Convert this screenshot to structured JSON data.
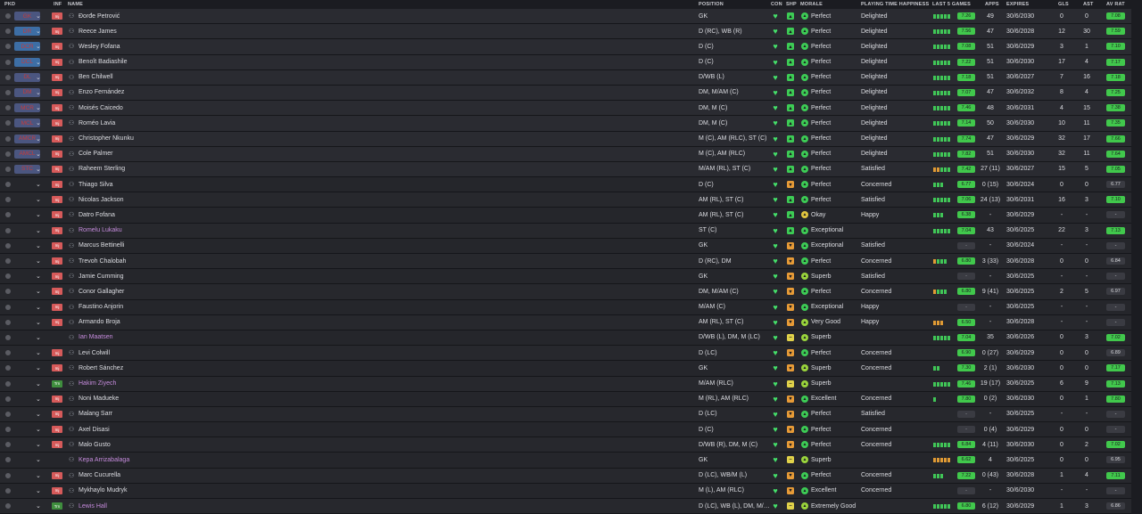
{
  "headers": {
    "pkd": "PKD",
    "inf": "INF",
    "name": "NAME",
    "position": "POSITION",
    "con": "CON",
    "shp": "SHP",
    "morale": "MORALE",
    "pth": "PLAYING TIME HAPPINESS",
    "last5": "LAST 5 GAMES",
    "apps": "APPS",
    "expires": "EXPIRES",
    "gls": "GLS",
    "ast": "AST",
    "avrat": "AV RAT"
  },
  "players": [
    {
      "sel": "GK",
      "inf": "Inj",
      "name": "Đorđe Petrović",
      "position": "GK",
      "morale": "Perfect",
      "pth": "Delighted",
      "last5": "ggggg",
      "rating": "7.26",
      "apps": "49",
      "expires": "30/6/2030",
      "gls": "0",
      "ast": "0",
      "avrat": "7.08"
    },
    {
      "sel": "DR",
      "inf": "Inj",
      "name": "Reece James",
      "position": "D (RC), WB (R)",
      "morale": "Perfect",
      "pth": "Delighted",
      "last5": "ggggg",
      "rating": "7.56",
      "apps": "47",
      "expires": "30/6/2028",
      "gls": "12",
      "ast": "30",
      "avrat": "7.59"
    },
    {
      "sel": "DCR",
      "inf": "Inj",
      "name": "Wesley Fofana",
      "position": "D (C)",
      "morale": "Perfect",
      "pth": "Delighted",
      "last5": "ggggg",
      "rating": "7.08",
      "apps": "51",
      "expires": "30/6/2029",
      "gls": "3",
      "ast": "1",
      "avrat": "7.10"
    },
    {
      "sel": "DCL",
      "inf": "Inj",
      "name": "Benoît Badiashile",
      "position": "D (C)",
      "morale": "Perfect",
      "pth": "Delighted",
      "last5": "ggggg",
      "rating": "7.22",
      "apps": "51",
      "expires": "30/6/2030",
      "gls": "17",
      "ast": "4",
      "avrat": "7.17"
    },
    {
      "sel": "DL",
      "inf": "Inj",
      "name": "Ben Chilwell",
      "position": "D/WB (L)",
      "morale": "Perfect",
      "pth": "Delighted",
      "last5": "ggggg",
      "rating": "7.18",
      "apps": "51",
      "expires": "30/6/2027",
      "gls": "7",
      "ast": "16",
      "avrat": "7.18"
    },
    {
      "sel": "DM",
      "inf": "Inj",
      "name": "Enzo Fernández",
      "position": "DM, M/AM (C)",
      "morale": "Perfect",
      "pth": "Delighted",
      "last5": "ggggg",
      "rating": "7.07",
      "apps": "47",
      "expires": "30/6/2032",
      "gls": "8",
      "ast": "4",
      "avrat": "7.25"
    },
    {
      "sel": "MCR",
      "inf": "Inj",
      "name": "Moisés Caicedo",
      "position": "DM, M (C)",
      "morale": "Perfect",
      "pth": "Delighted",
      "last5": "ggggg",
      "rating": "7.46",
      "apps": "48",
      "expires": "30/6/2031",
      "gls": "4",
      "ast": "15",
      "avrat": "7.38"
    },
    {
      "sel": "MCL",
      "inf": "Inj",
      "name": "Roméo Lavia",
      "position": "DM, M (C)",
      "morale": "Perfect",
      "pth": "Delighted",
      "last5": "ggggg",
      "rating": "7.14",
      "apps": "50",
      "expires": "30/6/2030",
      "gls": "10",
      "ast": "11",
      "avrat": "7.35"
    },
    {
      "sel": "AMCR",
      "inf": "Inj",
      "name": "Christopher Nkunku",
      "position": "M (C), AM (RLC), ST (C)",
      "morale": "Perfect",
      "pth": "Delighted",
      "last5": "ggggg",
      "rating": "7.74",
      "apps": "47",
      "expires": "30/6/2029",
      "gls": "32",
      "ast": "17",
      "avrat": "7.66"
    },
    {
      "sel": "AMCL",
      "inf": "Inj",
      "name": "Cole Palmer",
      "position": "M (C), AM (RLC)",
      "morale": "Perfect",
      "pth": "Delighted",
      "last5": "ggggg",
      "rating": "7.82",
      "apps": "51",
      "expires": "30/6/2030",
      "gls": "32",
      "ast": "11",
      "avrat": "7.64"
    },
    {
      "sel": "STC",
      "inf": "Inj",
      "name": "Raheem Sterling",
      "position": "M/AM (RL), ST (C)",
      "morale": "Perfect",
      "pth": "Satisfied",
      "last5": "ooggg",
      "rating": "7.42",
      "apps": "27 (11)",
      "expires": "30/6/2027",
      "gls": "15",
      "ast": "5",
      "avrat": "7.05"
    },
    {
      "sel": "",
      "inf": "Inj",
      "name": "Thiago Silva",
      "position": "D (C)",
      "morale": "Perfect",
      "pth": "Concerned",
      "last5": "ggg",
      "rating": "6.77",
      "apps": "0 (15)",
      "expires": "30/6/2024",
      "gls": "0",
      "ast": "0",
      "avrat": "6.77"
    },
    {
      "sel": "",
      "inf": "Inj",
      "name": "Nicolas Jackson",
      "position": "AM (RL), ST (C)",
      "morale": "Perfect",
      "pth": "Satisfied",
      "last5": "ggggg",
      "rating": "7.06",
      "apps": "24 (13)",
      "expires": "30/6/2031",
      "gls": "16",
      "ast": "3",
      "avrat": "7.10"
    },
    {
      "sel": "",
      "inf": "Inj",
      "name": "Datro Fofana",
      "position": "AM (RL), ST (C)",
      "morale": "Okay",
      "pth": "Happy",
      "last5": "ggg",
      "rating": "6.38",
      "apps": "-",
      "expires": "30/6/2029",
      "gls": "-",
      "ast": "-",
      "avrat": "-"
    },
    {
      "sel": "",
      "inf": "Inj",
      "name": "Romelu Lukaku",
      "position": "ST (C)",
      "morale": "Exceptional",
      "pth": "",
      "last5": "ggggg",
      "rating": "7.04",
      "apps": "43",
      "expires": "30/6/2025",
      "gls": "22",
      "ast": "3",
      "avrat": "7.13"
    },
    {
      "sel": "",
      "inf": "Inj",
      "name": "Marcus Bettinelli",
      "position": "GK",
      "morale": "Exceptional",
      "pth": "Satisfied",
      "last5": "",
      "rating": "-",
      "apps": "-",
      "expires": "30/6/2024",
      "gls": "-",
      "ast": "-",
      "avrat": "-"
    },
    {
      "sel": "",
      "inf": "Inj",
      "name": "Trevoh Chalobah",
      "position": "D (RC), DM",
      "morale": "Perfect",
      "pth": "Concerned",
      "last5": "oggg",
      "rating": "6.80",
      "apps": "3 (33)",
      "expires": "30/6/2028",
      "gls": "0",
      "ast": "0",
      "avrat": "6.84"
    },
    {
      "sel": "",
      "inf": "Inj",
      "name": "Jamie Cumming",
      "position": "GK",
      "morale": "Superb",
      "pth": "Satisfied",
      "last5": "",
      "rating": "-",
      "apps": "-",
      "expires": "30/6/2025",
      "gls": "-",
      "ast": "-",
      "avrat": "-"
    },
    {
      "sel": "",
      "inf": "Inj",
      "name": "Conor Gallagher",
      "position": "DM, M/AM (C)",
      "morale": "Perfect",
      "pth": "Concerned",
      "last5": "oggg",
      "rating": "6.80",
      "apps": "9 (41)",
      "expires": "30/6/2025",
      "gls": "2",
      "ast": "5",
      "avrat": "6.97"
    },
    {
      "sel": "",
      "inf": "Inj",
      "name": "Faustino Anjorin",
      "position": "M/AM (C)",
      "morale": "Exceptional",
      "pth": "Happy",
      "last5": "",
      "rating": "-",
      "apps": "-",
      "expires": "30/6/2025",
      "gls": "-",
      "ast": "-",
      "avrat": "-"
    },
    {
      "sel": "",
      "inf": "Inj",
      "name": "Armando Broja",
      "position": "AM (RL), ST (C)",
      "morale": "Very Good",
      "pth": "Happy",
      "last5": "ooo",
      "rating": "6.50",
      "apps": "-",
      "expires": "30/6/2028",
      "gls": "-",
      "ast": "-",
      "avrat": "-"
    },
    {
      "sel": "",
      "inf": "",
      "name": "Ian Maatsen",
      "position": "D/WB (L), DM, M (LC)",
      "morale": "Superb",
      "pth": "",
      "last5": "ggggg",
      "rating": "7.04",
      "apps": "35",
      "expires": "30/6/2026",
      "gls": "0",
      "ast": "3",
      "avrat": "7.02"
    },
    {
      "sel": "",
      "inf": "Inj",
      "name": "Levi Colwill",
      "position": "D (LC)",
      "morale": "Perfect",
      "pth": "Concerned",
      "last5": "",
      "rating": "6.90",
      "apps": "0 (27)",
      "expires": "30/6/2029",
      "gls": "0",
      "ast": "0",
      "avrat": "6.89"
    },
    {
      "sel": "",
      "inf": "Inj",
      "name": "Robert Sánchez",
      "position": "GK",
      "morale": "Superb",
      "pth": "Concerned",
      "last5": "gg",
      "rating": "7.30",
      "apps": "2 (1)",
      "expires": "30/6/2030",
      "gls": "0",
      "ast": "0",
      "avrat": "7.17"
    },
    {
      "sel": "",
      "inf": "Trn",
      "name": "Hakim Ziyech",
      "position": "M/AM (RLC)",
      "morale": "Superb",
      "pth": "",
      "last5": "ggggg",
      "rating": "7.46",
      "apps": "19 (17)",
      "expires": "30/6/2025",
      "gls": "6",
      "ast": "9",
      "avrat": "7.13"
    },
    {
      "sel": "",
      "inf": "Inj",
      "name": "Noni Madueke",
      "position": "M (RL), AM (RLC)",
      "morale": "Excellent",
      "pth": "Concerned",
      "last5": "g",
      "rating": "7.80",
      "apps": "0 (2)",
      "expires": "30/6/2030",
      "gls": "0",
      "ast": "1",
      "avrat": "7.80"
    },
    {
      "sel": "",
      "inf": "Inj",
      "name": "Malang Sarr",
      "position": "D (LC)",
      "morale": "Perfect",
      "pth": "Satisfied",
      "last5": "",
      "rating": "-",
      "apps": "-",
      "expires": "30/6/2025",
      "gls": "-",
      "ast": "-",
      "avrat": "-"
    },
    {
      "sel": "",
      "inf": "Inj",
      "name": "Axel Disasi",
      "position": "D (C)",
      "morale": "Perfect",
      "pth": "Concerned",
      "last5": "",
      "rating": "-",
      "apps": "0 (4)",
      "expires": "30/6/2029",
      "gls": "0",
      "ast": "0",
      "avrat": "-"
    },
    {
      "sel": "",
      "inf": "Inj",
      "name": "Malo Gusto",
      "position": "D/WB (R), DM, M (C)",
      "morale": "Perfect",
      "pth": "Concerned",
      "last5": "ggggg",
      "rating": "6.84",
      "apps": "4 (11)",
      "expires": "30/6/2030",
      "gls": "0",
      "ast": "2",
      "avrat": "7.02"
    },
    {
      "sel": "",
      "inf": "",
      "name": "Kepa Arrizabalaga",
      "position": "GK",
      "morale": "Superb",
      "pth": "",
      "last5": "ooooo",
      "rating": "6.62",
      "apps": "4",
      "expires": "30/6/2025",
      "gls": "0",
      "ast": "0",
      "avrat": "6.95"
    },
    {
      "sel": "",
      "inf": "Inj",
      "name": "Marc Cucurella",
      "position": "D (LC), WB/M (L)",
      "morale": "Perfect",
      "pth": "Concerned",
      "last5": "ggg",
      "rating": "7.22",
      "apps": "0 (43)",
      "expires": "30/6/2028",
      "gls": "1",
      "ast": "4",
      "avrat": "7.11"
    },
    {
      "sel": "",
      "inf": "Inj",
      "name": "Mykhaylo Mudryk",
      "position": "M (L), AM (RLC)",
      "morale": "Excellent",
      "pth": "Concerned",
      "last5": "",
      "rating": "-",
      "apps": "-",
      "expires": "30/6/2030",
      "gls": "-",
      "ast": "-",
      "avrat": "-"
    },
    {
      "sel": "",
      "inf": "Trn",
      "name": "Lewis Hall",
      "position": "D (LC), WB (L), DM, M/…",
      "morale": "Extremely Good",
      "pth": "",
      "last5": "ggggg",
      "rating": "6.80",
      "apps": "6 (12)",
      "expires": "30/6/2029",
      "gls": "1",
      "ast": "3",
      "avrat": "6.86"
    }
  ]
}
